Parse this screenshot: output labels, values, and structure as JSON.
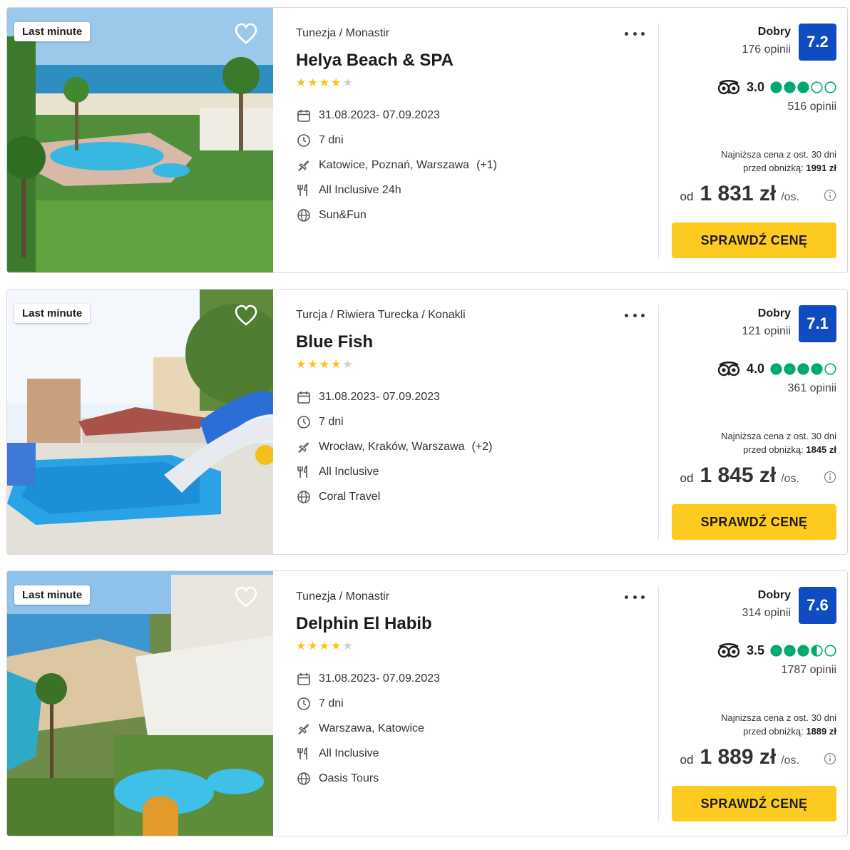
{
  "colors": {
    "score_bg": "#0f4cc2",
    "cta_bg": "#fdcb1f",
    "star": "#f6c514",
    "tripadvisor": "#00aa6c"
  },
  "icons": {
    "heart": "heart-icon",
    "menu": "more-dots-icon",
    "calendar": "calendar-icon",
    "clock": "clock-icon",
    "plane": "plane-icon",
    "food": "cutlery-icon",
    "globe": "globe-icon",
    "tripadvisor": "tripadvisor-owl-icon",
    "info": "info-icon"
  },
  "offers": [
    {
      "badge": "Last minute",
      "location": "Tunezja / Monastir",
      "name": "Helya Beach & SPA",
      "stars": 4,
      "dates": "31.08.2023- 07.09.2023",
      "duration": "7 dni",
      "departure": "Katowice, Poznań, Warszawa",
      "departure_extra": "(+1)",
      "board": "All Inclusive 24h",
      "operator": "Sun&Fun",
      "rating_label": "Dobry",
      "rating_count": "176 opinii",
      "score": "7.2",
      "ta_score": "3.0",
      "ta_bubbles": 3.0,
      "ta_count": "516 opinii",
      "lowest_line1": "Najniższa cena z ost. 30 dni",
      "lowest_line2": "przed obniżką:",
      "lowest_value": "1991 zł",
      "price_prefix": "od",
      "price": "1 831 zł",
      "price_unit": "/os.",
      "cta": "SPRAWDŹ CENĘ"
    },
    {
      "badge": "Last minute",
      "location": "Turcja / Riwiera Turecka / Konakli",
      "name": "Blue Fish",
      "stars": 4,
      "dates": "31.08.2023- 07.09.2023",
      "duration": "7 dni",
      "departure": "Wrocław, Kraków, Warszawa",
      "departure_extra": "(+2)",
      "board": "All Inclusive",
      "operator": "Coral Travel",
      "rating_label": "Dobry",
      "rating_count": "121 opinii",
      "score": "7.1",
      "ta_score": "4.0",
      "ta_bubbles": 4.0,
      "ta_count": "361 opinii",
      "lowest_line1": "Najniższa cena z ost. 30 dni",
      "lowest_line2": "przed obniżką:",
      "lowest_value": "1845 zł",
      "price_prefix": "od",
      "price": "1 845 zł",
      "price_unit": "/os.",
      "cta": "SPRAWDŹ CENĘ"
    },
    {
      "badge": "Last minute",
      "location": "Tunezja / Monastir",
      "name": "Delphin El Habib",
      "stars": 4,
      "dates": "31.08.2023- 07.09.2023",
      "duration": "7 dni",
      "departure": "Warszawa, Katowice",
      "departure_extra": "",
      "board": "All Inclusive",
      "operator": "Oasis Tours",
      "rating_label": "Dobry",
      "rating_count": "314 opinii",
      "score": "7.6",
      "ta_score": "3.5",
      "ta_bubbles": 3.5,
      "ta_count": "1787 opinii",
      "lowest_line1": "Najniższa cena z ost. 30 dni",
      "lowest_line2": "przed obniżką:",
      "lowest_value": "1889 zł",
      "price_prefix": "od",
      "price": "1 889 zł",
      "price_unit": "/os.",
      "cta": "SPRAWDŹ CENĘ"
    }
  ]
}
